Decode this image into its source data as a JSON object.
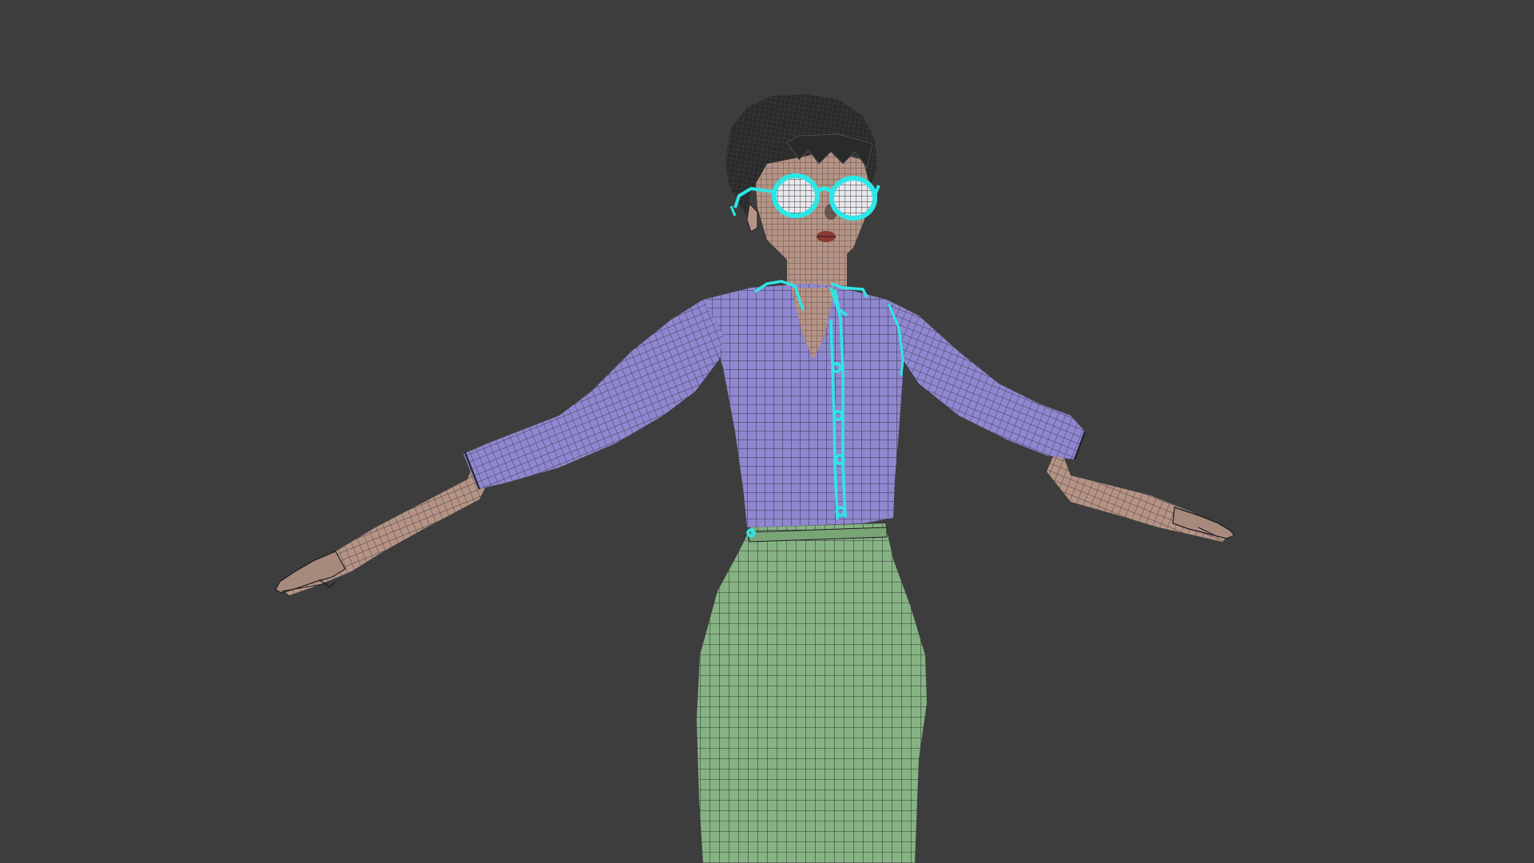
{
  "viewport": {
    "background_color": "#3d3d3d",
    "view_mode": "wireframe-on-shaded",
    "pose": "T-pose"
  },
  "model": {
    "parts": [
      {
        "name": "hair",
        "color": "#2a2a2a"
      },
      {
        "name": "skin",
        "color": "#b59486"
      },
      {
        "name": "shirt",
        "color": "#8f87cf"
      },
      {
        "name": "skirt",
        "color": "#86b383"
      },
      {
        "name": "lips",
        "color": "#8a3a30"
      }
    ],
    "selection": {
      "items": [
        "glasses",
        "shirt-collar",
        "shirt-placket",
        "shirt-seams",
        "skirt-waistband-edge"
      ],
      "highlight_color": "#2ee6e6"
    },
    "wireframe_color": "#1c1c22"
  }
}
